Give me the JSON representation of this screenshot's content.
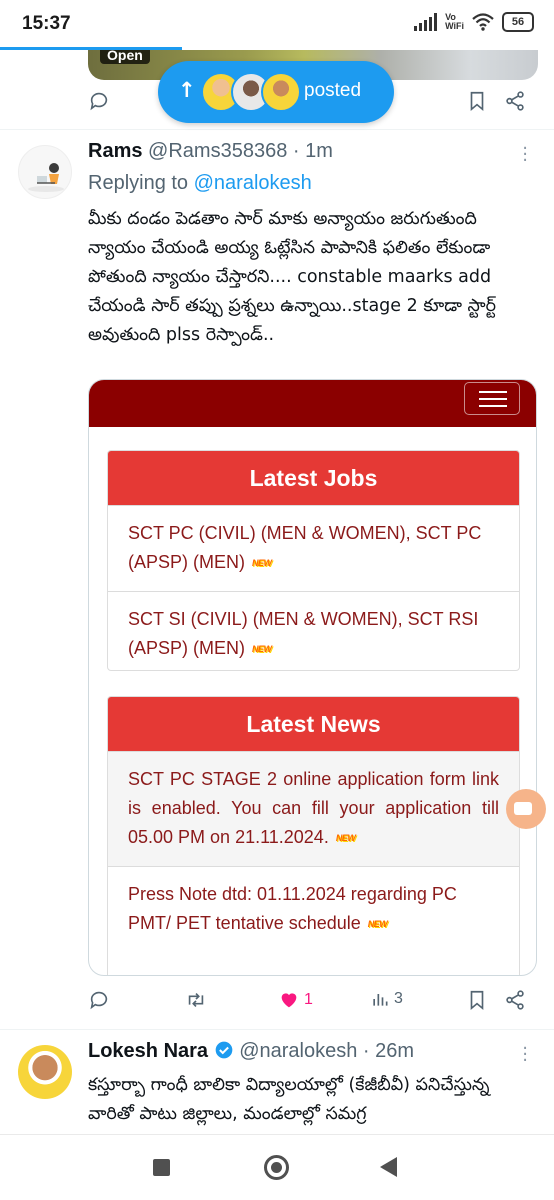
{
  "status_bar": {
    "time": "15:37",
    "network_label_top": "Vo",
    "network_label_bottom": "WiFi",
    "battery": "56"
  },
  "previous_tweet": {
    "media_badge": "Open"
  },
  "posted_pill": {
    "label": "posted"
  },
  "tweet_rams": {
    "name": "Rams",
    "handle": "@Rams358368",
    "time": "1m",
    "replying_prefix": "Replying to ",
    "replying_to": "@naralokesh",
    "text": "మీకు దండం పెడతాం సార్ మాకు అన్యాయం జరుగుతుంది న్యాయం చేయండి అయ్య ఓట్లేసిన పాపానికి ఫలితం లేకుండా పోతుంది న్యాయం చేస్తారని.... constable maarks add చేయండి సార్ తప్పు ప్రశ్నలు ఉన్నాయి..stage 2 కూడా స్టార్ట్ అవుతుంది plss రెస్పాండ్..",
    "media": {
      "latest_jobs": {
        "title": "Latest Jobs",
        "items": [
          "SCT PC (CIVIL) (MEN & WOMEN), SCT PC (APSP) (MEN)",
          "SCT SI (CIVIL) (MEN & WOMEN), SCT RSI (APSP) (MEN)"
        ]
      },
      "latest_news": {
        "title": "Latest News",
        "items": [
          "SCT PC STAGE 2 online application form link is enabled. You can fill your application till 05.00 PM on 21.11.2024.",
          "Press Note dtd: 01.11.2024 regarding PC PMT/ PET tentative schedule"
        ]
      },
      "new_badge": "NEW"
    },
    "likes": "1",
    "views": "3"
  },
  "tweet_lokesh": {
    "name": "Lokesh Nara",
    "handle": "@naralokesh",
    "time": "26m",
    "text": "కస్తూర్బా గాంధీ బాలికా విద్యాలయాల్లో (కేజీబీవీ) పనిచేస్తున్న వారితో పాటు జిల్లాలు, మండలాల్లో సమగ్ర"
  },
  "colors": {
    "accent": "#1d9bf0",
    "like": "#f91880",
    "banner_dark_red": "#8b0000",
    "panel_red": "#e53935"
  },
  "icons": [
    "reply-icon",
    "retweet-icon",
    "heart-icon",
    "views-icon",
    "bookmark-icon",
    "share-icon",
    "verified-icon",
    "more-icon"
  ]
}
